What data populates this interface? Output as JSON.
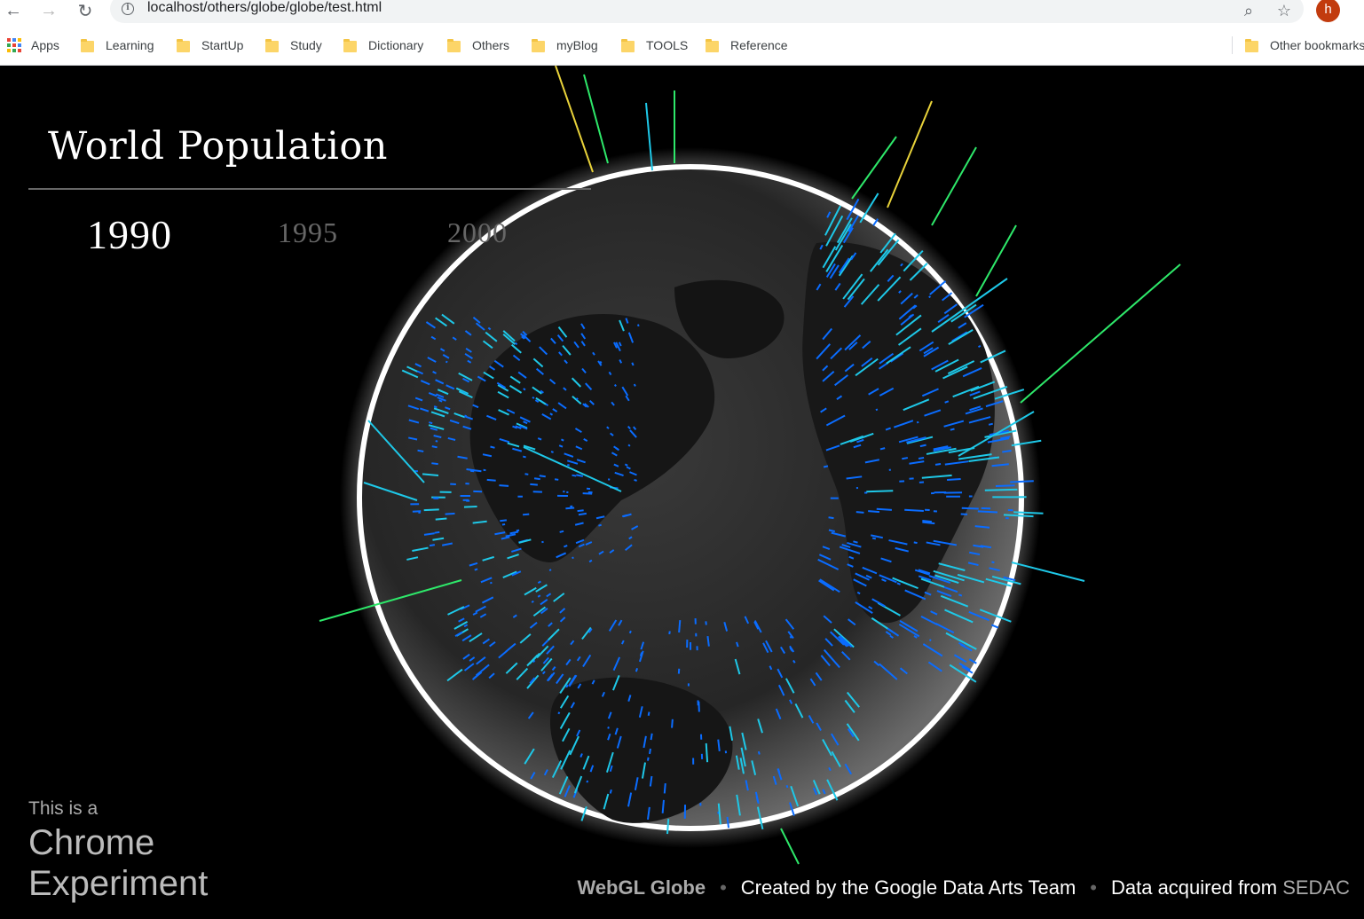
{
  "browser": {
    "url": "localhost/others/globe/globe/test.html",
    "avatar_initial": "h",
    "bookmarks": [
      {
        "label": "Apps",
        "type": "apps"
      },
      {
        "label": "Learning",
        "type": "folder"
      },
      {
        "label": "StartUp",
        "type": "folder"
      },
      {
        "label": "Study",
        "type": "folder"
      },
      {
        "label": "Dictionary",
        "type": "folder"
      },
      {
        "label": "Others",
        "type": "folder"
      },
      {
        "label": "myBlog",
        "type": "folder"
      },
      {
        "label": "TOOLS",
        "type": "folder"
      },
      {
        "label": "Reference",
        "type": "folder"
      }
    ],
    "other_bookmarks": "Other bookmarks"
  },
  "page": {
    "title": "World Population",
    "years": [
      {
        "label": "1990",
        "active": true
      },
      {
        "label": "1995",
        "active": false
      },
      {
        "label": "2000",
        "active": false
      }
    ],
    "chrome_experiment": {
      "line1": "This is a",
      "line2": "Chrome",
      "line3": "Experiment"
    },
    "footer": {
      "webgl": "WebGL Globe",
      "credit": "Created by the Google Data Arts Team",
      "data_prefix": "Data acquired from",
      "data_source": "SEDAC"
    }
  },
  "colors": {
    "background": "#000000",
    "bar_low": "#0a6cff",
    "bar_mid": "#1ec8e8",
    "bar_high": "#2ee86a",
    "bar_peak": "#e8d23a",
    "globe_rim": "#ffffff"
  }
}
